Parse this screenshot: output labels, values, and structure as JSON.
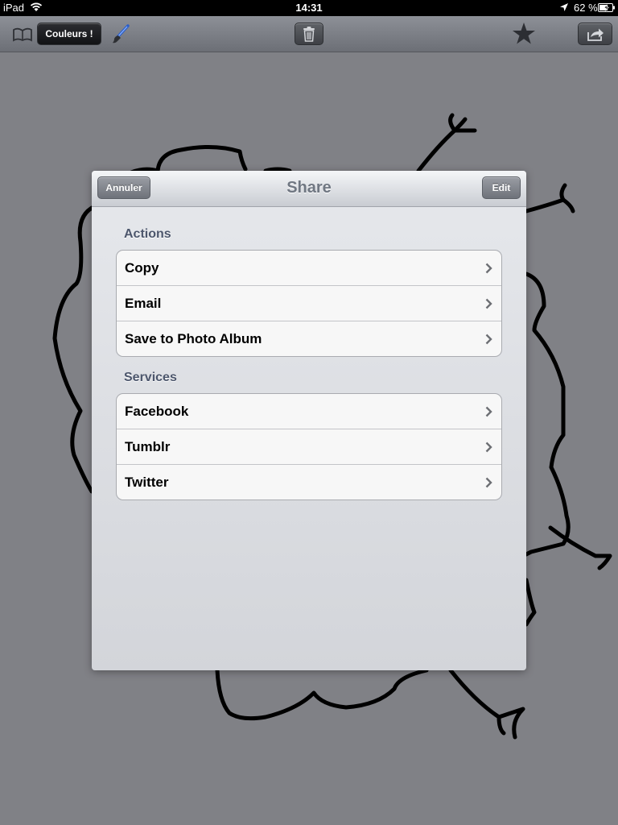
{
  "status_bar": {
    "carrier": "iPad",
    "time": "14:31",
    "battery": "62 %"
  },
  "toolbar": {
    "colors_label": "Couleurs !"
  },
  "share_sheet": {
    "title": "Share",
    "cancel_label": "Annuler",
    "edit_label": "Edit",
    "sections": [
      {
        "header": "Actions",
        "items": [
          "Copy",
          "Email",
          "Save to Photo Album"
        ]
      },
      {
        "header": "Services",
        "items": [
          "Facebook",
          "Tumblr",
          "Twitter"
        ]
      }
    ]
  }
}
